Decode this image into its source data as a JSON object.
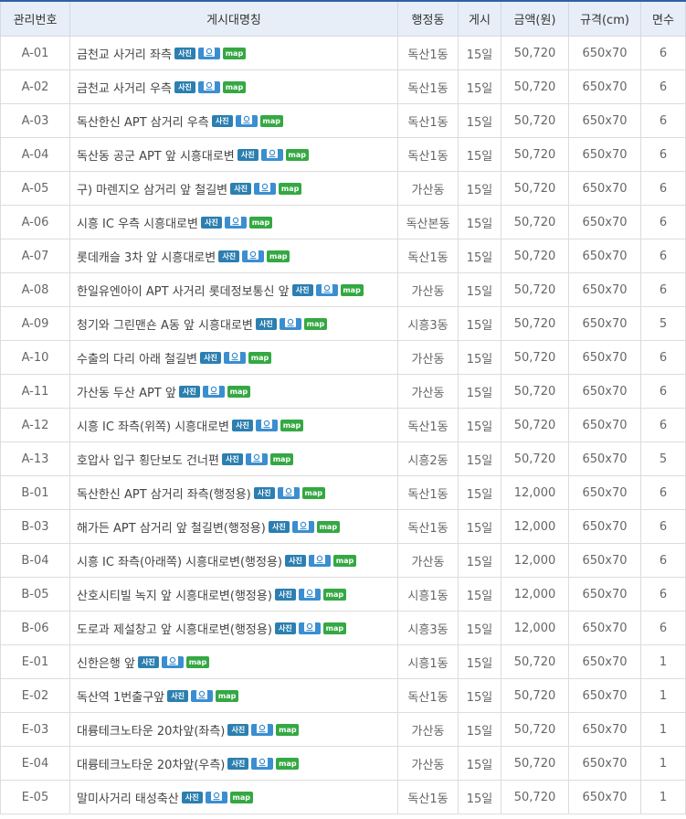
{
  "header": {
    "col_id": "관리번호",
    "col_name": "게시대명칭",
    "col_dong": "행정동",
    "col_period": "게시",
    "col_price": "금액(원)",
    "col_size": "규격(cm)",
    "col_faces": "면수"
  },
  "buttons": {
    "photo": "사진",
    "map": "map"
  },
  "rows": [
    {
      "id": "A-01",
      "name": "금천교 사거리 좌측",
      "dong": "독산1동",
      "period": "15일",
      "price": "50,720",
      "size": "650x70",
      "faces": "6"
    },
    {
      "id": "A-02",
      "name": "금천교 사거리 우측",
      "dong": "독산1동",
      "period": "15일",
      "price": "50,720",
      "size": "650x70",
      "faces": "6"
    },
    {
      "id": "A-03",
      "name": "독산한신 APT 삼거리 우측",
      "dong": "독산1동",
      "period": "15일",
      "price": "50,720",
      "size": "650x70",
      "faces": "6"
    },
    {
      "id": "A-04",
      "name": "독산동 공군 APT 앞 시흥대로변",
      "dong": "독산1동",
      "period": "15일",
      "price": "50,720",
      "size": "650x70",
      "faces": "6"
    },
    {
      "id": "A-05",
      "name": "구) 마렌지오 삼거리 앞 철길변",
      "dong": "가산동",
      "period": "15일",
      "price": "50,720",
      "size": "650x70",
      "faces": "6"
    },
    {
      "id": "A-06",
      "name": "시흥 IC 우측 시흥대로변",
      "dong": "독산본동",
      "period": "15일",
      "price": "50,720",
      "size": "650x70",
      "faces": "6"
    },
    {
      "id": "A-07",
      "name": "롯데캐슬 3차 앞 시흥대로변",
      "dong": "독산1동",
      "period": "15일",
      "price": "50,720",
      "size": "650x70",
      "faces": "6"
    },
    {
      "id": "A-08",
      "name": "한일유엔아이 APT 사거리 롯데정보통신 앞",
      "dong": "가산동",
      "period": "15일",
      "price": "50,720",
      "size": "650x70",
      "faces": "6"
    },
    {
      "id": "A-09",
      "name": "청기와 그린맨숀 A동 앞 시흥대로변",
      "dong": "시흥3동",
      "period": "15일",
      "price": "50,720",
      "size": "650x70",
      "faces": "5"
    },
    {
      "id": "A-10",
      "name": "수출의 다리 아래 철길변",
      "dong": "가산동",
      "period": "15일",
      "price": "50,720",
      "size": "650x70",
      "faces": "6"
    },
    {
      "id": "A-11",
      "name": "가산동 두산 APT 앞",
      "dong": "가산동",
      "period": "15일",
      "price": "50,720",
      "size": "650x70",
      "faces": "6"
    },
    {
      "id": "A-12",
      "name": "시흥 IC 좌측(위쪽) 시흥대로변",
      "dong": "독산1동",
      "period": "15일",
      "price": "50,720",
      "size": "650x70",
      "faces": "6"
    },
    {
      "id": "A-13",
      "name": "호압사 입구 횡단보도 건너편",
      "dong": "시흥2동",
      "period": "15일",
      "price": "50,720",
      "size": "650x70",
      "faces": "5"
    },
    {
      "id": "B-01",
      "name": "독산한신 APT 삼거리 좌측(행정용)",
      "dong": "독산1동",
      "period": "15일",
      "price": "12,000",
      "size": "650x70",
      "faces": "6"
    },
    {
      "id": "B-03",
      "name": "해가든 APT 삼거리 앞 철길변(행정용)",
      "dong": "독산1동",
      "period": "15일",
      "price": "12,000",
      "size": "650x70",
      "faces": "6"
    },
    {
      "id": "B-04",
      "name": "시흥 IC 좌측(아래쪽) 시흥대로변(행정용)",
      "dong": "가산동",
      "period": "15일",
      "price": "12,000",
      "size": "650x70",
      "faces": "6"
    },
    {
      "id": "B-05",
      "name": "산호시티빌 녹지 앞 시흥대로변(행정용)",
      "dong": "시흥1동",
      "period": "15일",
      "price": "12,000",
      "size": "650x70",
      "faces": "6"
    },
    {
      "id": "B-06",
      "name": "도로과 제설창고 앞 시흥대로변(행정용)",
      "dong": "시흥3동",
      "period": "15일",
      "price": "12,000",
      "size": "650x70",
      "faces": "6"
    },
    {
      "id": "E-01",
      "name": "신한은행 앞",
      "dong": "시흥1동",
      "period": "15일",
      "price": "50,720",
      "size": "650x70",
      "faces": "1"
    },
    {
      "id": "E-02",
      "name": "독산역 1번출구앞",
      "dong": "독산1동",
      "period": "15일",
      "price": "50,720",
      "size": "650x70",
      "faces": "1"
    },
    {
      "id": "E-03",
      "name": "대륭테크노타운 20차앞(좌측)",
      "dong": "가산동",
      "period": "15일",
      "price": "50,720",
      "size": "650x70",
      "faces": "1"
    },
    {
      "id": "E-04",
      "name": "대륭테크노타운 20차앞(우측)",
      "dong": "가산동",
      "period": "15일",
      "price": "50,720",
      "size": "650x70",
      "faces": "1"
    },
    {
      "id": "E-05",
      "name": "말미사거리 태성축산",
      "dong": "독산1동",
      "period": "15일",
      "price": "50,720",
      "size": "650x70",
      "faces": "1"
    }
  ]
}
